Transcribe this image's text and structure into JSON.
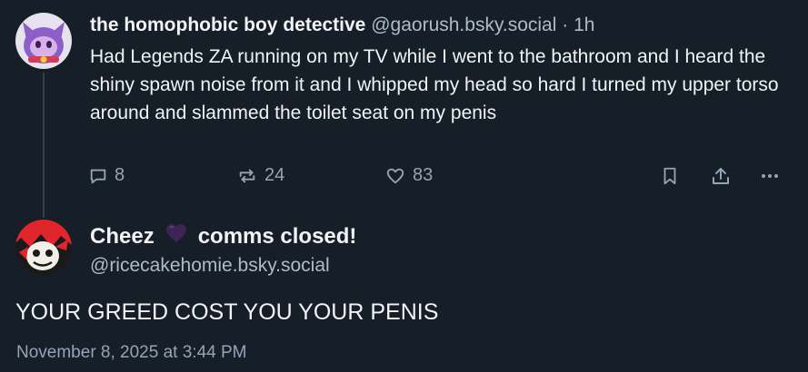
{
  "parent_post": {
    "display_name": "the homophobic boy detective",
    "handle": "@gaorush.bsky.social",
    "separator": "·",
    "time_ago": "1h",
    "text": "Had Legends ZA running on my TV while I went to the bathroom and I heard the shiny spawn noise from it and I whipped my head so hard I turned my upper torso around and slammed the toilet seat on my penis",
    "reply_count": "8",
    "repost_count": "24",
    "like_count": "83",
    "icons": {
      "reply": "speech-bubble-icon",
      "repost": "repost-arrows-icon",
      "like": "heart-outline-icon",
      "bookmark": "bookmark-icon",
      "share": "share-upload-icon",
      "more": "ellipsis-icon"
    }
  },
  "focused_post": {
    "display_name_part1": "Cheez",
    "display_name_emoji": "purple-heart-emoji",
    "display_name_part2": "comms closed!",
    "handle": "@ricecakehomie.bsky.social",
    "text": "YOUR GREED COST YOU YOUR PENIS",
    "date": "November 8, 2025 at 3:44 PM"
  },
  "colors": {
    "background": "#161e27",
    "text_primary": "#f1f3f5",
    "text_secondary": "#aebbc9",
    "icon": "#93a5b7",
    "thread_line": "#2e4052"
  }
}
